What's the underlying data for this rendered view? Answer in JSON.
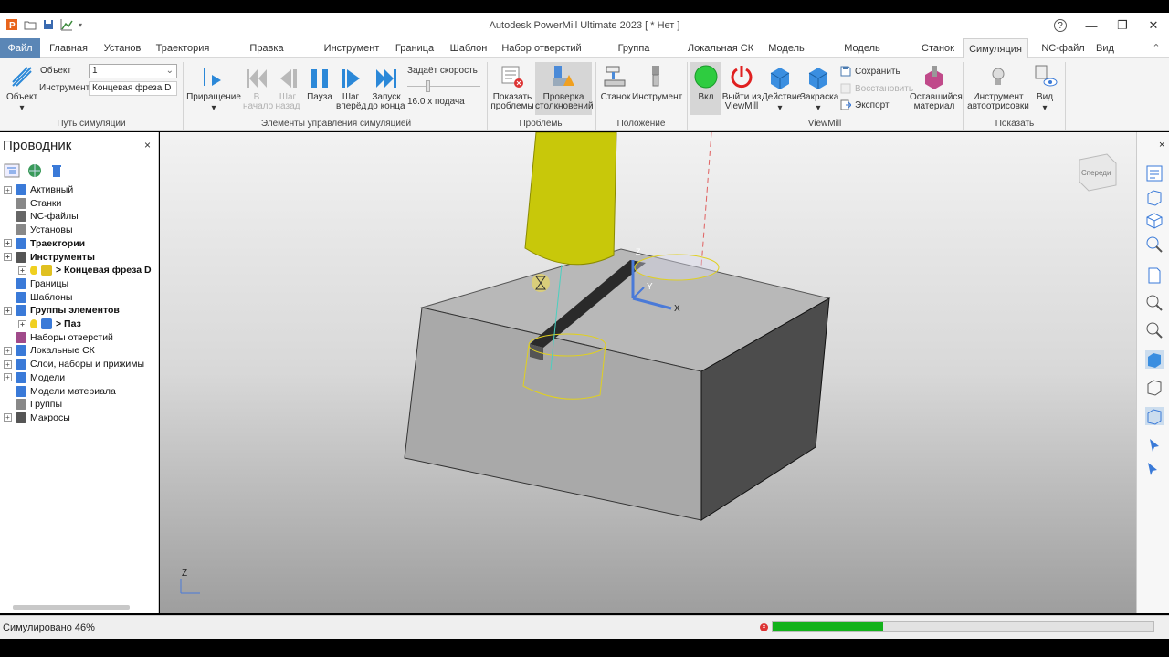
{
  "window": {
    "title": "Autodesk PowerMill Ultimate 2023    [  * Нет ]",
    "help": "?",
    "minimize": "—",
    "restore": "❐",
    "close": "✕"
  },
  "menu": {
    "tabs": [
      "Файл",
      "Главная",
      "Установ",
      "Траектория",
      "Правка траектории",
      "Инструмент",
      "Граница",
      "Шаблон",
      "Набор отверстий",
      "Группа элементов",
      "Локальная СК",
      "Модель",
      "Модель материала",
      "Станок",
      "Симуляция",
      "NC-файл",
      "Вид"
    ],
    "active_tab": "Симуляция",
    "collapse": "⌃"
  },
  "ribbon": {
    "object_button": "Объект",
    "object_label": "Объект",
    "object_value": "1",
    "tool_label": "Инструмент",
    "tool_value": "Концевая фреза D",
    "group_path": "Путь симуляции",
    "increment": "Приращение",
    "to_start_1": "В",
    "to_start_2": "начало",
    "step_back_1": "Шаг",
    "step_back_2": "назад",
    "pause": "Пауза",
    "step_fwd_1": "Шаг",
    "step_fwd_2": "вперёд",
    "run_end_1": "Запуск",
    "run_end_2": "до конца",
    "speed_label": "Задаёт скорость",
    "speed_value": "16.0 x подача",
    "group_controls": "Элементы управления симуляцией",
    "show_problems_1": "Показать",
    "show_problems_2": "проблемы",
    "collision_1": "Проверка",
    "collision_2": "столкновений",
    "group_problems": "Проблемы",
    "machine": "Станок",
    "tool": "Инструмент",
    "group_position": "Положение",
    "on": "Вкл",
    "exit_1": "Выйти из",
    "exit_2": "ViewMill",
    "action": "Действие",
    "shading": "Закраска",
    "save": "Сохранить",
    "restore": "Восстановить",
    "export": "Экспорт",
    "remaining_1": "Оставшийся",
    "remaining_2": "материал",
    "group_viewmill": "ViewMill",
    "autodraw_1": "Инструмент",
    "autodraw_2": "автоотрисовки",
    "view": "Вид",
    "group_show": "Показать"
  },
  "explorer": {
    "title": "Проводник",
    "close": "×",
    "items": [
      {
        "label": "Активный",
        "expand": true,
        "bold": false,
        "indent": 0,
        "icon": "active-icon"
      },
      {
        "label": "Станки",
        "expand": false,
        "bold": false,
        "indent": 0,
        "icon": "machine-icon"
      },
      {
        "label": "NC-файлы",
        "expand": false,
        "bold": false,
        "indent": 0,
        "icon": "ncfile-icon"
      },
      {
        "label": "Установы",
        "expand": false,
        "bold": false,
        "indent": 0,
        "icon": "setup-icon"
      },
      {
        "label": "Траектории",
        "expand": true,
        "bold": true,
        "indent": 0,
        "icon": "toolpath-icon"
      },
      {
        "label": "Инструменты",
        "expand": true,
        "bold": true,
        "indent": 0,
        "icon": "tools-icon"
      },
      {
        "label": "> Концевая фреза D",
        "expand": true,
        "bold": true,
        "indent": 1,
        "icon": "endmill-icon"
      },
      {
        "label": "Границы",
        "expand": false,
        "bold": false,
        "indent": 0,
        "icon": "boundary-icon"
      },
      {
        "label": "Шаблоны",
        "expand": false,
        "bold": false,
        "indent": 0,
        "icon": "pattern-icon"
      },
      {
        "label": "Группы элементов",
        "expand": true,
        "bold": true,
        "indent": 0,
        "icon": "featureset-icon"
      },
      {
        "label": "> Паз",
        "expand": true,
        "bold": true,
        "indent": 1,
        "icon": "slot-icon"
      },
      {
        "label": "Наборы отверстий",
        "expand": false,
        "bold": false,
        "indent": 0,
        "icon": "holeset-icon"
      },
      {
        "label": "Локальные СК",
        "expand": true,
        "bold": false,
        "indent": 0,
        "icon": "workplane-icon"
      },
      {
        "label": "Слои, наборы и прижимы",
        "expand": true,
        "bold": false,
        "indent": 0,
        "icon": "layers-icon"
      },
      {
        "label": "Модели",
        "expand": true,
        "bold": false,
        "indent": 0,
        "icon": "model-icon"
      },
      {
        "label": "Модели материала",
        "expand": false,
        "bold": false,
        "indent": 0,
        "icon": "stockmodel-icon"
      },
      {
        "label": "Группы",
        "expand": false,
        "bold": false,
        "indent": 0,
        "icon": "group-icon"
      },
      {
        "label": "Макросы",
        "expand": true,
        "bold": false,
        "indent": 0,
        "icon": "macro-icon"
      }
    ]
  },
  "viewport": {
    "cube_label": "Спереди",
    "axis_x": "X",
    "axis_y": "Y",
    "axis_z": "Z"
  },
  "status": {
    "text": "Симулировано 46%",
    "progress": 0.29
  },
  "colors": {
    "file_tab": "#5a86b6",
    "tool_yellow": "#c8c80a",
    "progress": "#13b21b",
    "on_green": "#2ecc40",
    "exit_red": "#e02020"
  }
}
